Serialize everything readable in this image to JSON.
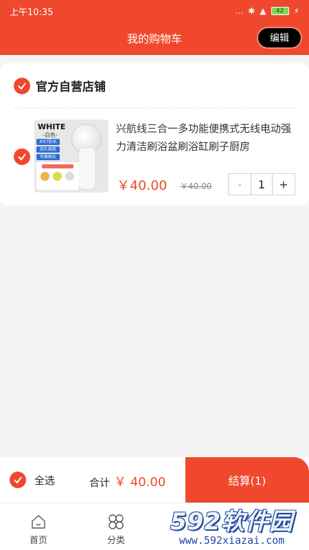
{
  "status_bar": {
    "time": "上午10:35",
    "signal": "...",
    "battery": "42"
  },
  "header": {
    "title": "我的购物车",
    "edit_label": "编辑"
  },
  "shop": {
    "name": "官方自营店铺",
    "checked": true
  },
  "item": {
    "title": "兴航线三合一多功能便携式无线电动强力清洁刷浴盆刷浴缸刷子厨房",
    "price": "￥40.00",
    "original_price": "￥40.00",
    "quantity": "1",
    "minus_label": "-",
    "plus_label": "+",
    "checked": true,
    "image": {
      "label_white": "WHITE",
      "label_color": "-白色-",
      "tags": [
        "IPX7防水",
        "持久续航",
        "可换刷头"
      ]
    }
  },
  "footer": {
    "select_all_label": "全选",
    "total_label": "合计",
    "total_value": "￥ 40.00",
    "checkout_label": "结算(1)"
  },
  "tabbar": {
    "items": [
      {
        "label": "首页",
        "icon": "home-icon"
      },
      {
        "label": "分类",
        "icon": "category-icon"
      }
    ]
  },
  "watermark": {
    "main": "592软件园",
    "url": "www.592xiazai.com"
  },
  "colors": {
    "accent": "#f0482c",
    "watermark": "#1d4aa8"
  }
}
